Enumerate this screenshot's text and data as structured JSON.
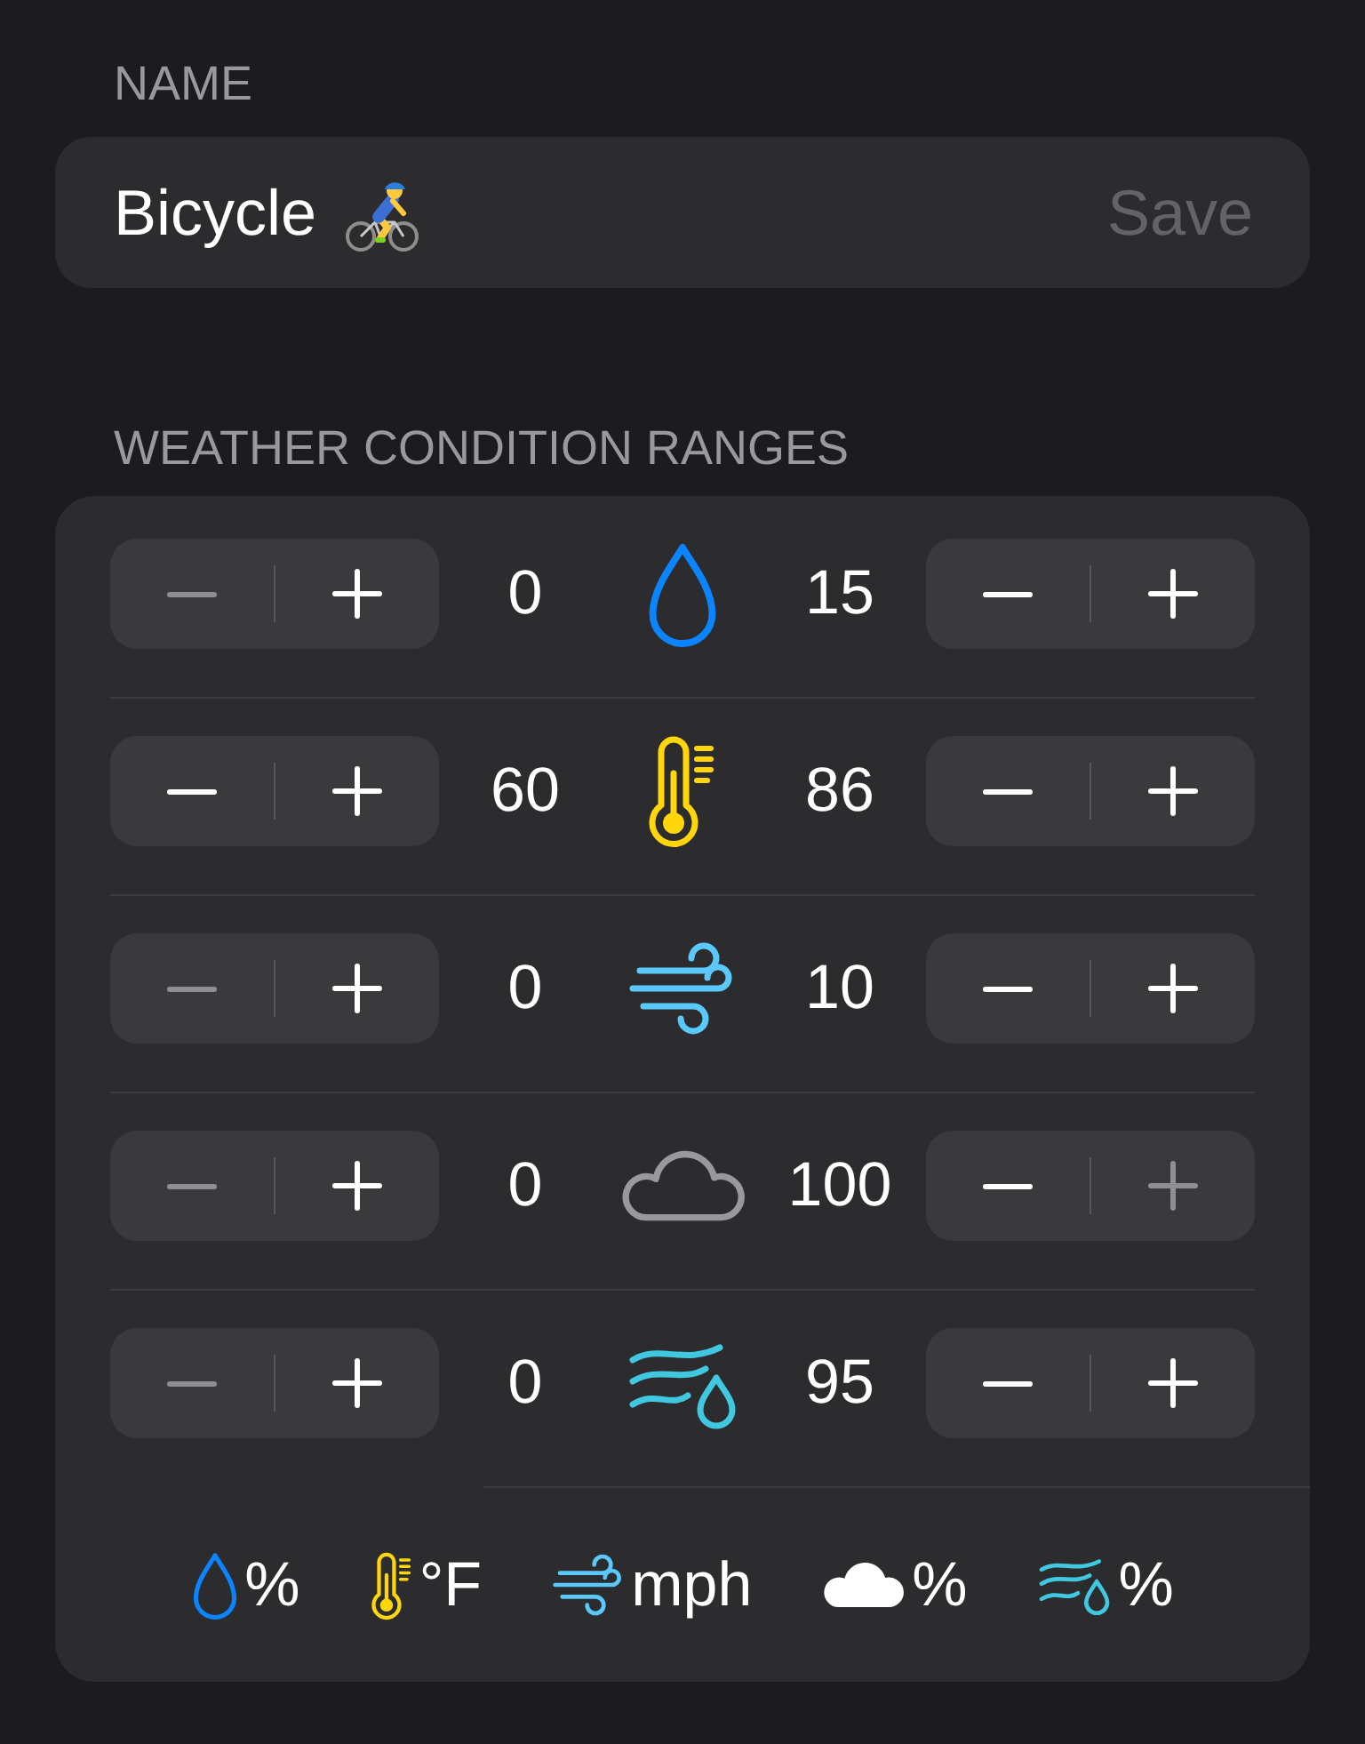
{
  "name_section": {
    "header": "NAME",
    "field": {
      "value": "Bicycle",
      "save_label": "Save",
      "save_disabled": true
    }
  },
  "ranges_section": {
    "header": "WEATHER CONDITION RANGES",
    "rows": [
      {
        "kind": "precipitation",
        "lower": {
          "value": "0",
          "decrement_disabled": true,
          "increment_disabled": false
        },
        "upper": {
          "value": "15",
          "decrement_disabled": false,
          "increment_disabled": false
        }
      },
      {
        "kind": "temperature",
        "lower": {
          "value": "60",
          "decrement_disabled": false,
          "increment_disabled": false
        },
        "upper": {
          "value": "86",
          "decrement_disabled": false,
          "increment_disabled": false
        }
      },
      {
        "kind": "wind",
        "lower": {
          "value": "0",
          "decrement_disabled": true,
          "increment_disabled": false
        },
        "upper": {
          "value": "10",
          "decrement_disabled": false,
          "increment_disabled": false
        }
      },
      {
        "kind": "cloud_cover",
        "lower": {
          "value": "0",
          "decrement_disabled": true,
          "increment_disabled": false
        },
        "upper": {
          "value": "100",
          "decrement_disabled": false,
          "increment_disabled": true
        }
      },
      {
        "kind": "humidity",
        "lower": {
          "value": "0",
          "decrement_disabled": true,
          "increment_disabled": false
        },
        "upper": {
          "value": "95",
          "decrement_disabled": false,
          "increment_disabled": false
        }
      }
    ],
    "legend": [
      {
        "kind": "precipitation",
        "unit": "%"
      },
      {
        "kind": "temperature",
        "unit": "°F"
      },
      {
        "kind": "wind",
        "unit": "mph"
      },
      {
        "kind": "cloud_cover",
        "unit": "%"
      },
      {
        "kind": "humidity",
        "unit": "%"
      }
    ]
  }
}
